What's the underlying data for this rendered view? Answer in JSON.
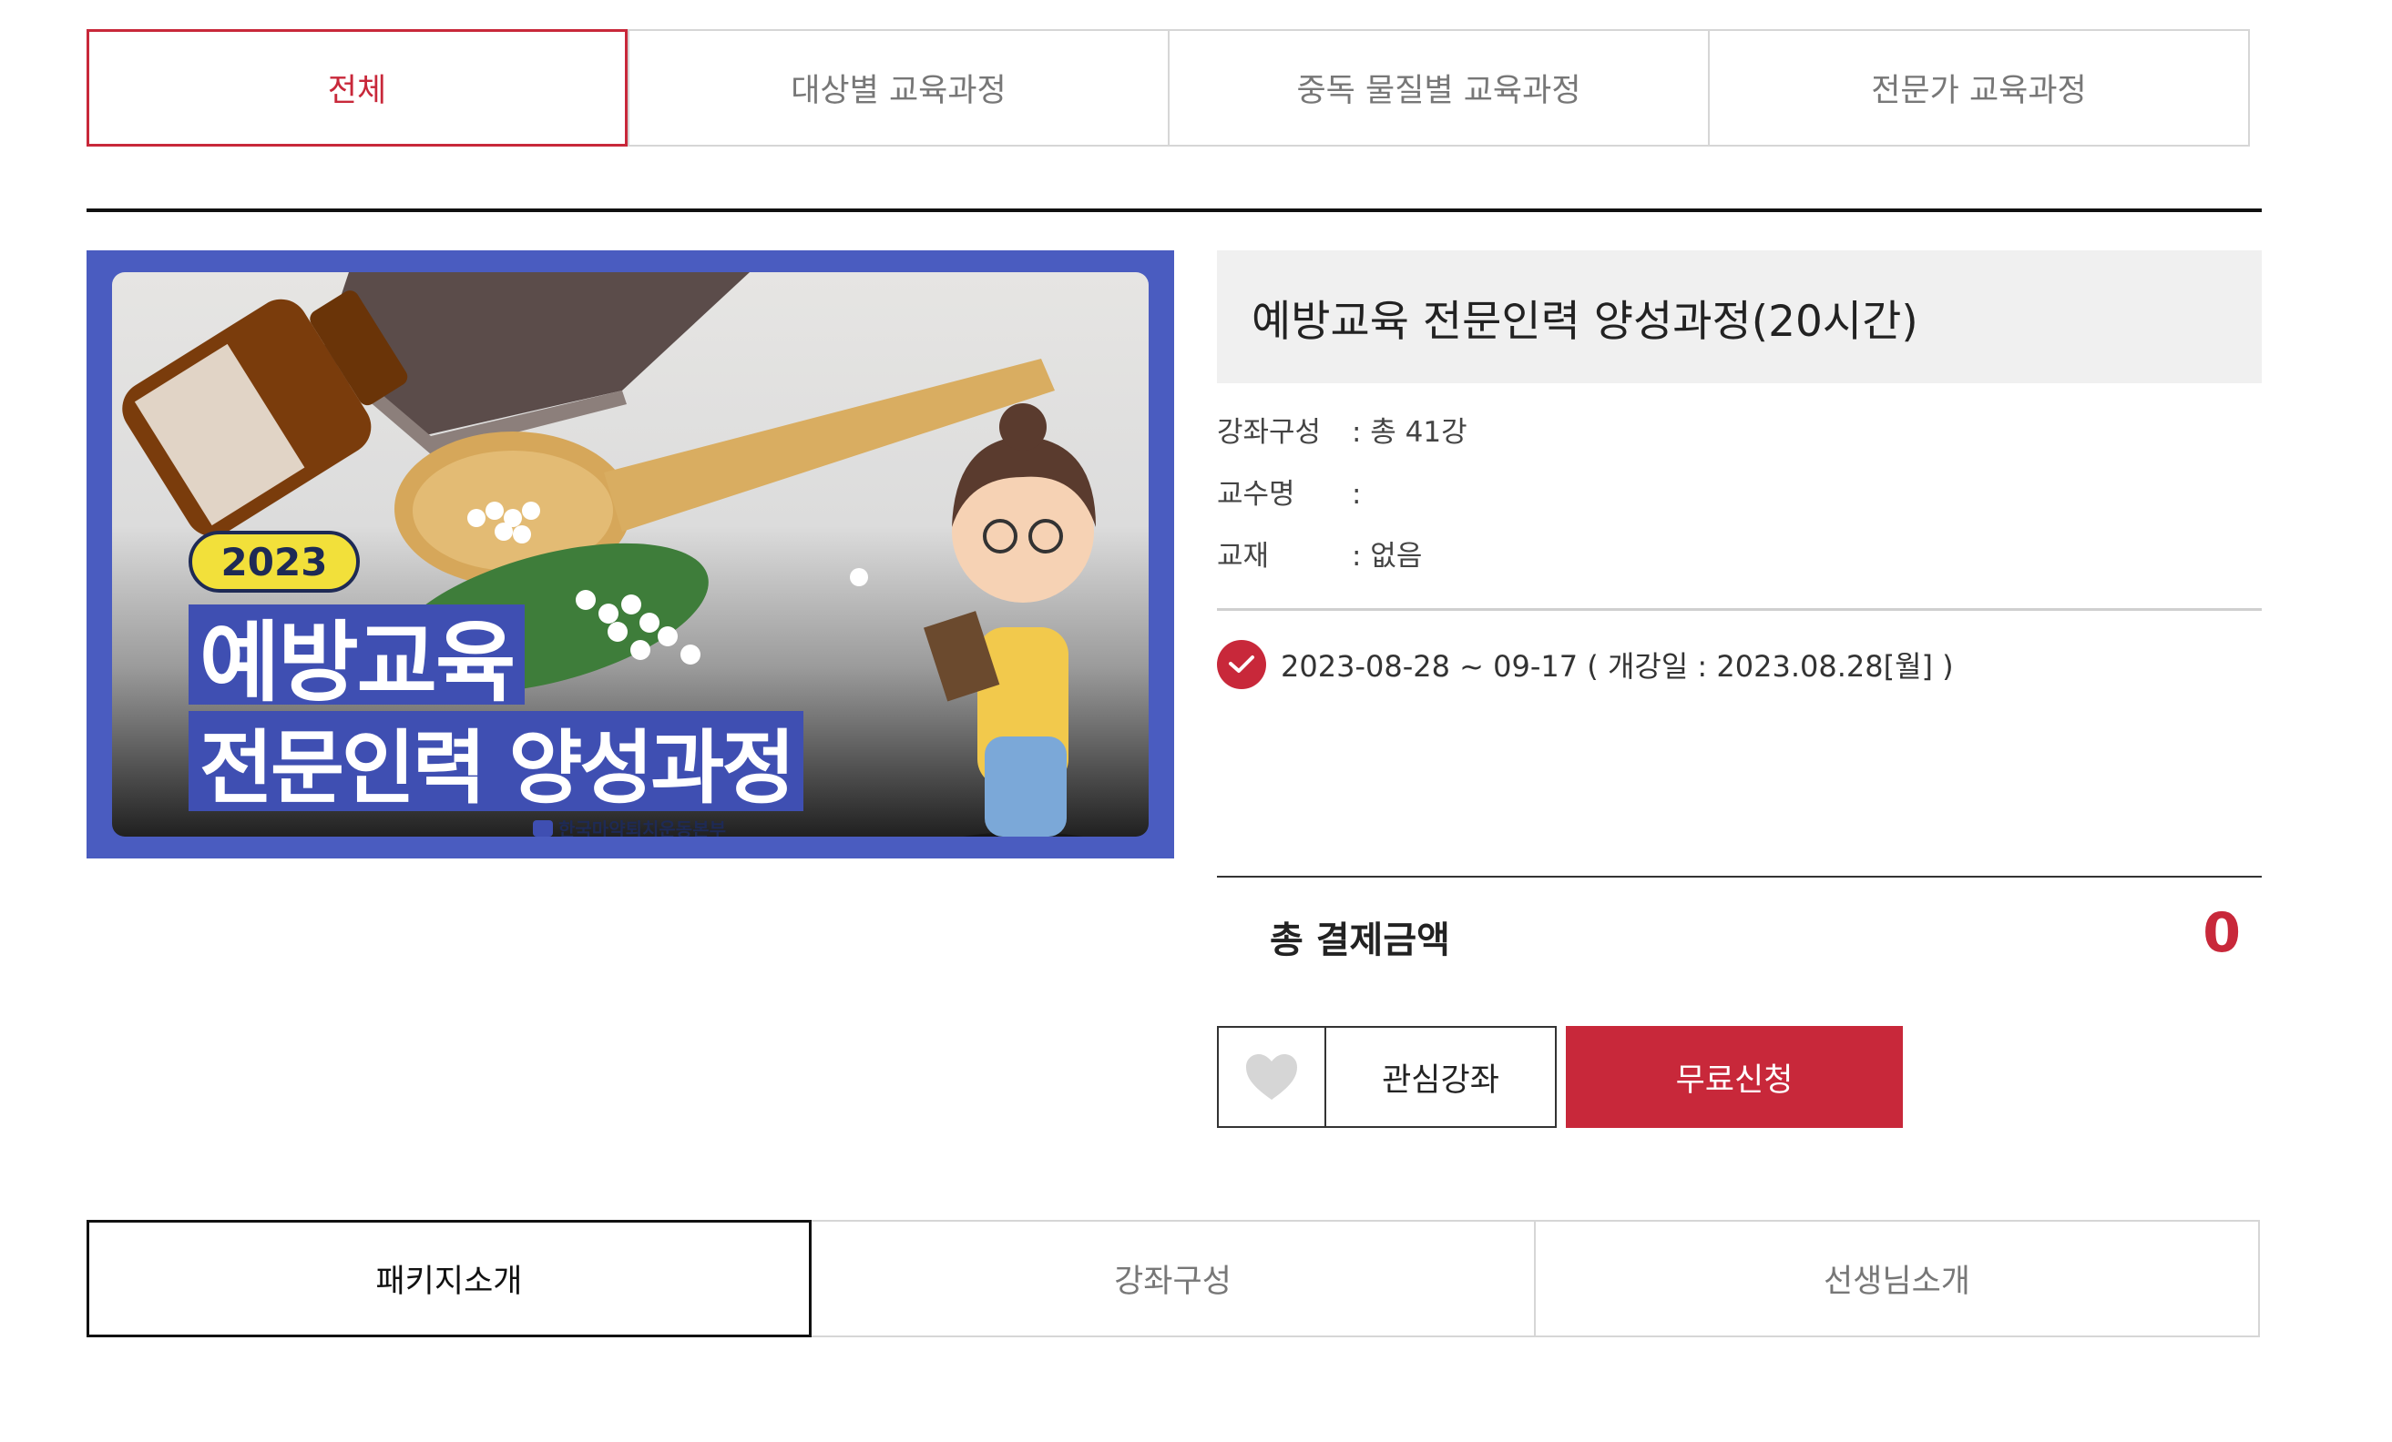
{
  "top_tabs": [
    {
      "label": "전체",
      "active": true
    },
    {
      "label": "대상별 교육과정",
      "active": false
    },
    {
      "label": "중독 물질별 교육과정",
      "active": false
    },
    {
      "label": "전문가 교육과정",
      "active": false
    }
  ],
  "course": {
    "title": "예방교육 전문인력 양성과정(20시간)",
    "thumbnail": {
      "year_badge": "2023",
      "headline_line1": "예방교육",
      "headline_line2": "전문인력 양성과정",
      "org_logo_text": "한국마약퇴치운동본부"
    },
    "info": [
      {
        "label": "강좌구성",
        "value": ": 총 41강"
      },
      {
        "label": "교수명",
        "value": ":"
      },
      {
        "label": "교재",
        "value": ": 없음"
      }
    ],
    "period": "2023-08-28 ~ 09-17 ( 개강일 : 2023.08.28[월] )",
    "total_label": "총 결제금액",
    "total_value": "0"
  },
  "actions": {
    "wishlist_label": "관심강좌",
    "apply_label": "무료신청"
  },
  "bottom_tabs": [
    {
      "label": "패키지소개",
      "active": true
    },
    {
      "label": "강좌구성",
      "active": false
    },
    {
      "label": "선생님소개",
      "active": false
    }
  ],
  "colors": {
    "accent": "#c8283a",
    "thumb_frame": "#4a5cc0",
    "badge_yellow": "#f2e03a"
  }
}
